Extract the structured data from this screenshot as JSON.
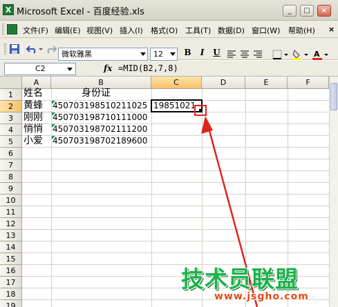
{
  "window": {
    "title": "Microsoft Excel - 百度经验.xls",
    "app_icon_letter": "X",
    "minimize": "_",
    "restore": "□",
    "close": "×"
  },
  "menu": {
    "items": [
      "文件(F)",
      "编辑(E)",
      "视图(V)",
      "插入(I)",
      "格式(O)",
      "工具(T)",
      "数据(D)",
      "窗口(W)",
      "帮助(H)"
    ],
    "close_doc": "×"
  },
  "toolbar": {
    "font_name": "微软雅黑",
    "font_size": "12",
    "bold": "B",
    "italic": "I",
    "underline": "U"
  },
  "formula_bar": {
    "name_box": "C2",
    "fx": "fx",
    "formula": "=MID(B2,7,8)"
  },
  "sheet": {
    "columns": [
      "A",
      "B",
      "C",
      "D",
      "E",
      "F"
    ],
    "rows": [
      "1",
      "2",
      "3",
      "4",
      "5",
      "6",
      "7",
      "8",
      "9",
      "10",
      "11",
      "12",
      "13",
      "14",
      "15",
      "16",
      "17",
      "18",
      "19"
    ],
    "active_cell": "C2",
    "cells": {
      "A1": "姓名",
      "B1": "身份证",
      "A2": "黄蜂",
      "B2": "450703198510211025",
      "C2": "19851021",
      "A3": "刚刚",
      "B3": "450703198710111000",
      "A4": "悄悄",
      "B4": "450703198702111200",
      "A5": "小爱",
      "B5": "450703198702189600"
    }
  },
  "watermark": {
    "main": "技术员联盟",
    "sub": "www.jsgho.com"
  },
  "colors": {
    "annotation": "#e0241b",
    "watermark_green": "#1bb24a",
    "watermark_orange": "#e24a18"
  }
}
